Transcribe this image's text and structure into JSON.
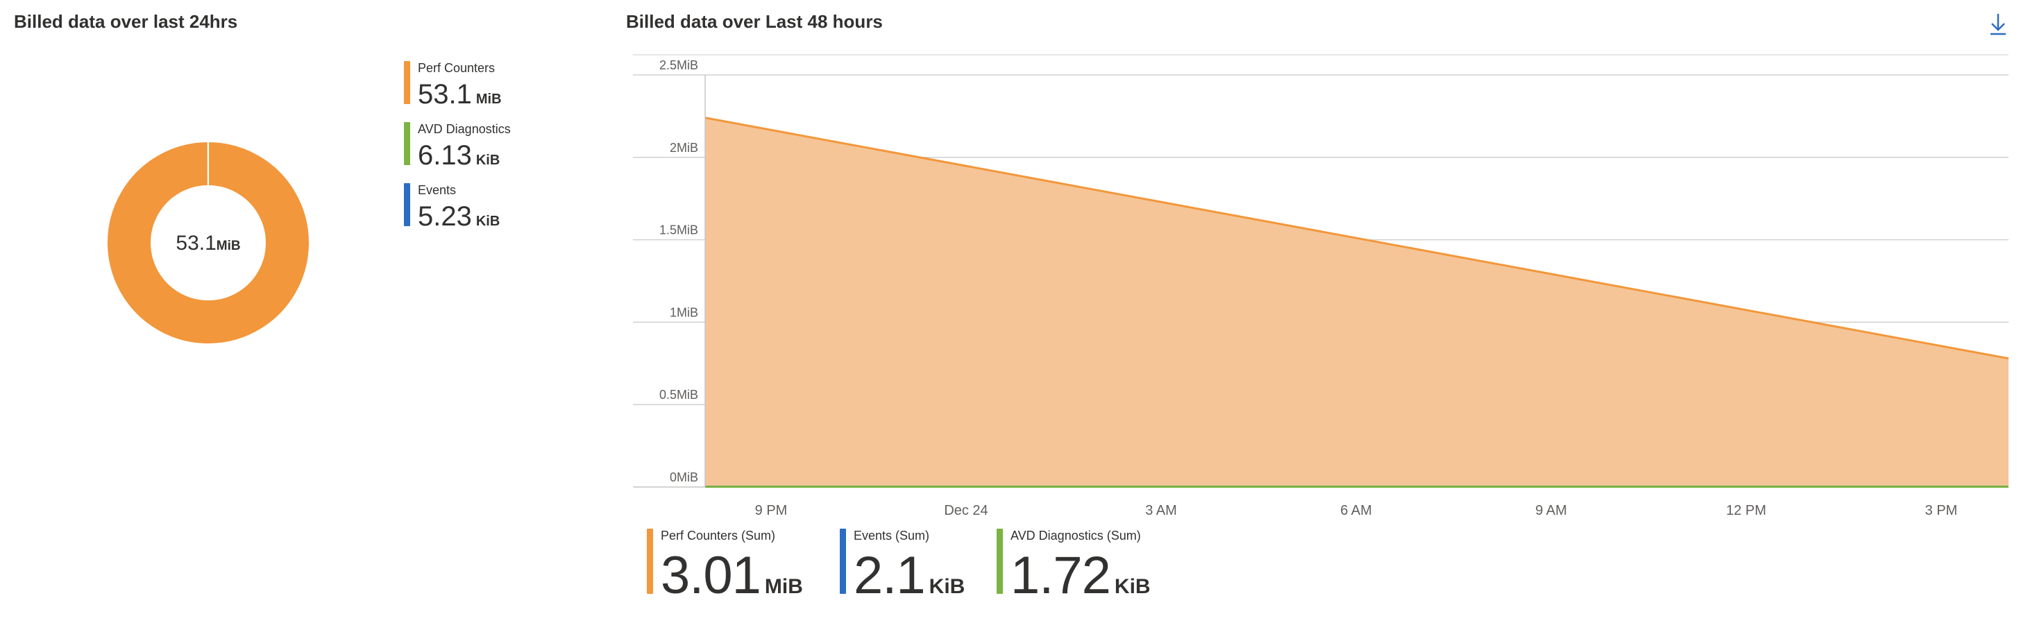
{
  "donut_panel": {
    "title": "Billed data over last 24hrs",
    "center_value": "53.1",
    "center_unit": "MiB",
    "legend": [
      {
        "label": "Perf Counters",
        "value": "53.1",
        "unit": "MiB",
        "color": "#f2973b"
      },
      {
        "label": "AVD Diagnostics",
        "value": "6.13",
        "unit": "KiB",
        "color": "#7cb342"
      },
      {
        "label": "Events",
        "value": "5.23",
        "unit": "KiB",
        "color": "#2b6cc4"
      }
    ]
  },
  "area_panel": {
    "title": "Billed data over Last 48 hours",
    "download_icon": "download-icon",
    "legend": [
      {
        "label": "Perf Counters (Sum)",
        "value": "3.01",
        "unit": "MiB",
        "color": "#f2973b"
      },
      {
        "label": "Events (Sum)",
        "value": "2.1",
        "unit": "KiB",
        "color": "#2b6cc4"
      },
      {
        "label": "AVD Diagnostics (Sum)",
        "value": "1.72",
        "unit": "KiB",
        "color": "#7cb342"
      }
    ]
  },
  "chart_data": [
    {
      "type": "pie",
      "title": "Billed data over last 24hrs",
      "categories": [
        "Perf Counters",
        "AVD Diagnostics",
        "Events"
      ],
      "values_mib": [
        53.1,
        0.005986,
        0.005107
      ],
      "colors": [
        "#f2973b",
        "#7cb342",
        "#2b6cc4"
      ],
      "center_label": "53.1MiB",
      "legend_placement": "right"
    },
    {
      "type": "area",
      "title": "Billed data over Last 48 hours",
      "xlabel": "",
      "ylabel": "",
      "ylim": [
        0,
        2.5
      ],
      "y_ticks": [
        0,
        0.5,
        1,
        1.5,
        2,
        2.5
      ],
      "y_tick_labels": [
        "0MiB",
        "0.5MiB",
        "1MiB",
        "1.5MiB",
        "2MiB",
        "2.5MiB"
      ],
      "x_ticks": [
        "9 PM",
        "Dec 24",
        "3 AM",
        "6 AM",
        "9 AM",
        "12 PM",
        "3 PM"
      ],
      "x_range": [
        "Dec 23 8:00 PM",
        "Dec 24 3:55 PM"
      ],
      "grid": true,
      "legend_placement": "bottom",
      "series": [
        {
          "name": "Perf Counters (Sum)",
          "color": "#f2973b",
          "fill": "#f5c597",
          "x": [
            "Dec 23 8:00 PM",
            "Dec 24 3:55 PM"
          ],
          "values": [
            2.24,
            0.78
          ]
        },
        {
          "name": "Events (Sum)",
          "color": "#2b6cc4",
          "x": [
            "Dec 23 8:00 PM",
            "Dec 24 3:55 PM"
          ],
          "values": [
            0.002,
            0.002
          ]
        },
        {
          "name": "AVD Diagnostics (Sum)",
          "color": "#7cb342",
          "x": [
            "Dec 23 8:00 PM",
            "Dec 24 3:55 PM"
          ],
          "values": [
            0.0017,
            0.0017
          ]
        }
      ]
    }
  ]
}
